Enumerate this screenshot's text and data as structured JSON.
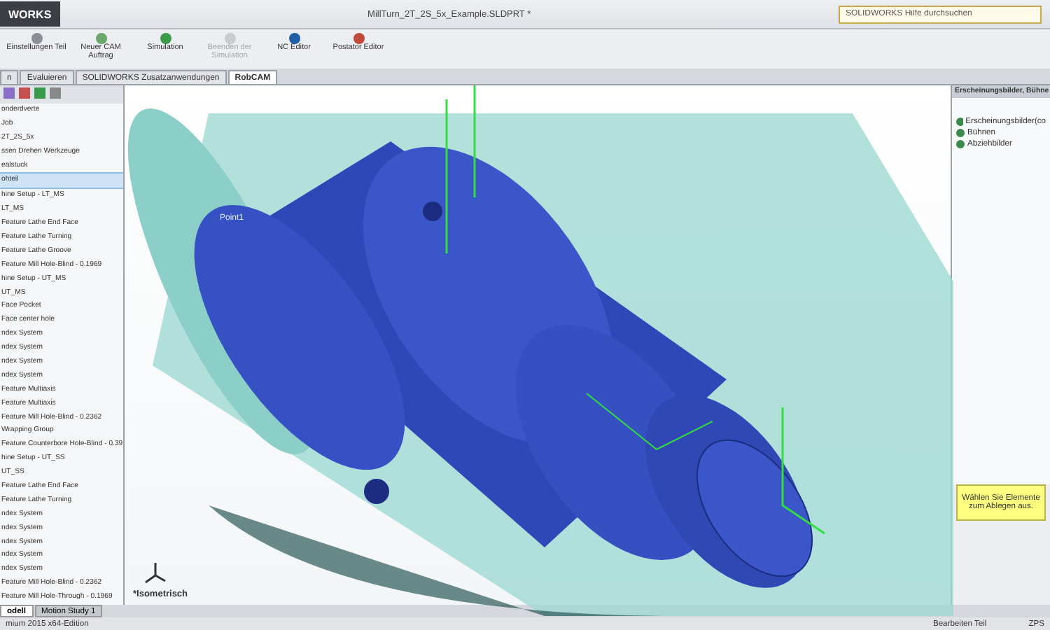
{
  "window": {
    "logo": "WORKS",
    "title": "MillTurn_2T_2S_5x_Example.SLDPRT *"
  },
  "search": {
    "placeholder": "SOLIDWORKS Hilfe durchsuchen"
  },
  "ribbon": {
    "buttons": [
      {
        "label": "Einstellungen Teil",
        "disabled": false
      },
      {
        "label": "Neuer CAM Auftrag",
        "disabled": false
      },
      {
        "label": "Simulation",
        "disabled": false
      },
      {
        "label": "Beenden der Simulation",
        "disabled": true
      },
      {
        "label": "NC Editor",
        "disabled": false
      },
      {
        "label": "Postator Editor",
        "disabled": false
      }
    ]
  },
  "command_tabs": [
    {
      "label": "n",
      "selected": false
    },
    {
      "label": "Evaluieren",
      "selected": false
    },
    {
      "label": "SOLIDWORKS Zusatzanwendungen",
      "selected": false
    },
    {
      "label": "RobCAM",
      "selected": true
    }
  ],
  "feature_tree": {
    "items": [
      {
        "label": "onderdverte",
        "selected": false
      },
      {
        "label": "Job",
        "selected": false
      },
      {
        "label": "2T_2S_5x",
        "selected": false
      },
      {
        "label": "ssen Drehen Werkzeuge",
        "selected": false
      },
      {
        "label": "ealstuck",
        "selected": false
      },
      {
        "label": "ohteil",
        "selected": true
      },
      {
        "label": "hine Setup - LT_MS",
        "selected": false
      },
      {
        "label": "LT_MS",
        "selected": false
      },
      {
        "label": "Feature Lathe End Face",
        "selected": false
      },
      {
        "label": "Feature Lathe Turning",
        "selected": false
      },
      {
        "label": "Feature Lathe Groove",
        "selected": false
      },
      {
        "label": "Feature Mill Hole-Blind - 0.1969",
        "selected": false
      },
      {
        "label": "hine Setup - UT_MS",
        "selected": false
      },
      {
        "label": "UT_MS",
        "selected": false
      },
      {
        "label": "Face Pocket",
        "selected": false
      },
      {
        "label": "Face center hole",
        "selected": false
      },
      {
        "label": "ndex System",
        "selected": false
      },
      {
        "label": "ndex System",
        "selected": false
      },
      {
        "label": "ndex System",
        "selected": false
      },
      {
        "label": "ndex System",
        "selected": false
      },
      {
        "label": "Feature Multiaxis",
        "selected": false
      },
      {
        "label": "Feature Multiaxis",
        "selected": false
      },
      {
        "label": "Feature Mill Hole-Blind - 0.2362",
        "selected": false
      },
      {
        "label": "Wrapping Group",
        "selected": false
      },
      {
        "label": "Feature Counterbore Hole-Blind - 0.39",
        "selected": false
      },
      {
        "label": "hine Setup - UT_SS",
        "selected": false
      },
      {
        "label": "UT_SS",
        "selected": false
      },
      {
        "label": "Feature Lathe End Face",
        "selected": false
      },
      {
        "label": "Feature Lathe Turning",
        "selected": false
      },
      {
        "label": "ndex System",
        "selected": false
      },
      {
        "label": "ndex System",
        "selected": false
      },
      {
        "label": "ndex System",
        "selected": false
      },
      {
        "label": "ndex System",
        "selected": false
      },
      {
        "label": "ndex System",
        "selected": false
      },
      {
        "label": "Feature Mill Hole-Blind - 0.2362",
        "selected": false
      },
      {
        "label": "Feature Mill Hole-Through - 0.1969",
        "selected": false
      }
    ]
  },
  "viewport": {
    "point_label": "Point1",
    "view_label": "*Isometrisch"
  },
  "task_pane": {
    "title": "Erscheinungsbilder, Bühne",
    "items": [
      "Erscheinungsbilder(co",
      "Bühnen",
      "Abziehbilder"
    ],
    "hint": "Wählen Sie Elemente zum Ablegen aus."
  },
  "bottom_tabs": [
    {
      "label": "odell",
      "selected": true
    },
    {
      "label": "Motion Study 1",
      "selected": false
    }
  ],
  "status_bar": {
    "product": "mium 2015 x64-Edition",
    "mode": "Bearbeiten Teil",
    "units": "ZPS"
  }
}
